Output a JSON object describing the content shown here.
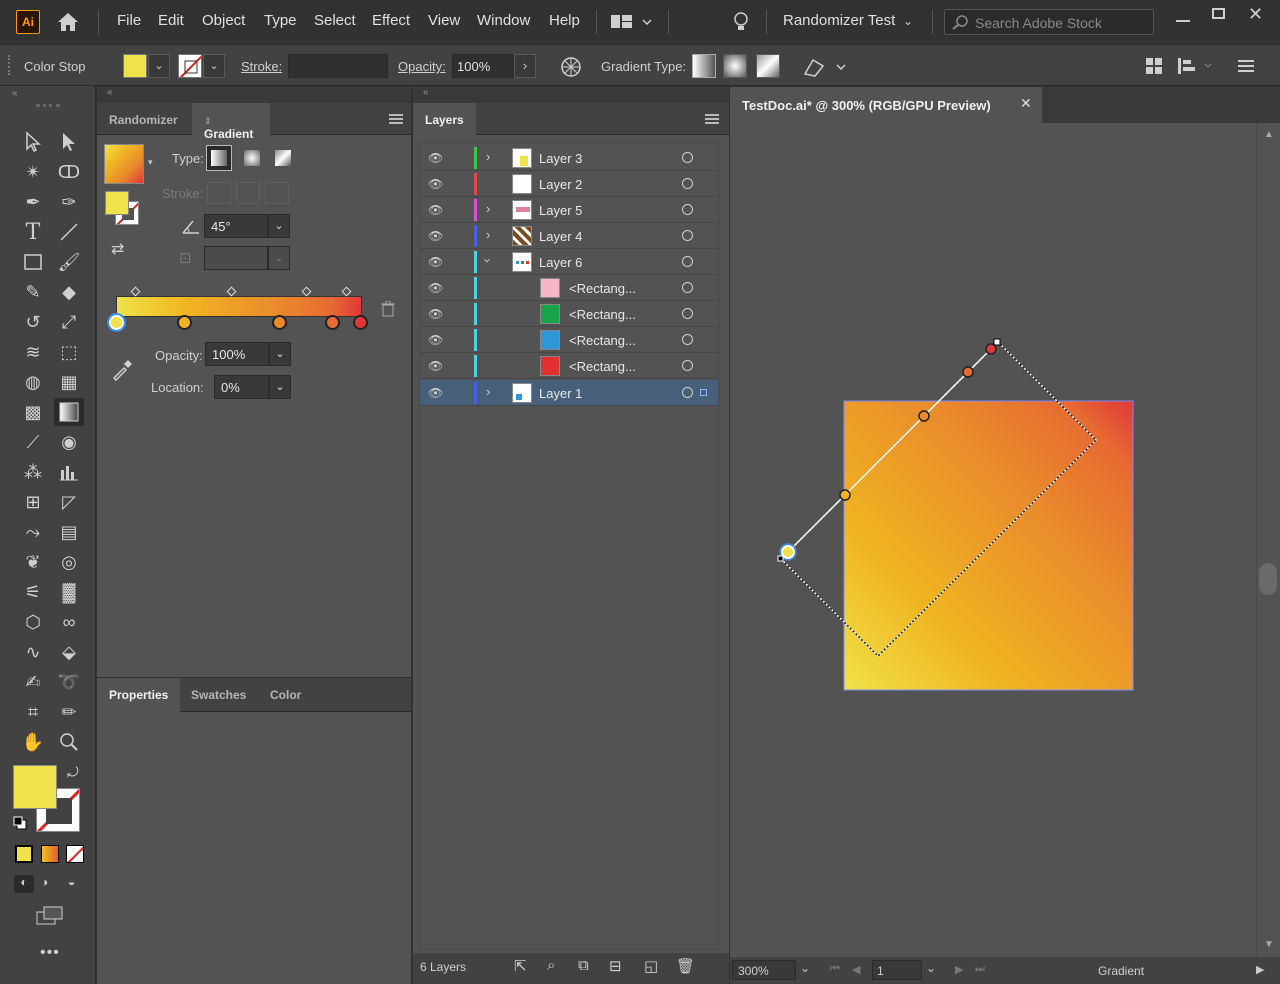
{
  "app": {
    "logo": "Ai",
    "doc_title": "Randomizer Test",
    "search_placeholder": "Search Adobe Stock"
  },
  "menu": [
    "File",
    "Edit",
    "Object",
    "Type",
    "Select",
    "Effect",
    "View",
    "Window",
    "Help"
  ],
  "control_bar": {
    "context_label": "Color Stop",
    "stroke_label": "Stroke:",
    "opacity_label": "Opacity:",
    "opacity_value": "100%",
    "gradient_type_label": "Gradient Type:"
  },
  "gradient_panel": {
    "tabs": [
      "Randomizer",
      "Gradient"
    ],
    "type_label": "Type:",
    "stroke_label": "Stroke:",
    "angle_value": "45°",
    "opacity_label": "Opacity:",
    "opacity_value": "100%",
    "location_label": "Location:",
    "location_value": "0%",
    "colors": {
      "start": "#f0e24a",
      "mid1": "#f0b521",
      "mid2": "#e98a2c",
      "mid3": "#e76a32",
      "end": "#e03838"
    }
  },
  "bottom_panel": {
    "tabs": [
      "Properties",
      "Swatches",
      "Color"
    ]
  },
  "layers_panel": {
    "title": "Layers",
    "footer": "6 Layers",
    "rows": [
      {
        "name": "Layer 3",
        "color": "#3ec446",
        "expand": true
      },
      {
        "name": "Layer 2",
        "color": "#e24b4b",
        "expand": false
      },
      {
        "name": "Layer 5",
        "color": "#d653d6",
        "expand": true
      },
      {
        "name": "Layer 4",
        "color": "#4b5fe2",
        "expand": true
      },
      {
        "name": "Layer 6",
        "color": "#4bd3e2",
        "expand": true
      },
      {
        "name": "<Rectang...",
        "color": "#4bd3e2",
        "swatch": "#f7b6c8"
      },
      {
        "name": "<Rectang...",
        "color": "#4bd3e2",
        "swatch": "#19a34a"
      },
      {
        "name": "<Rectang...",
        "color": "#4bd3e2",
        "swatch": "#3196d8"
      },
      {
        "name": "<Rectang...",
        "color": "#4bd3e2",
        "swatch": "#e03030"
      },
      {
        "name": "Layer 1",
        "color": "#4b5fe2",
        "expand": true
      }
    ]
  },
  "document": {
    "tab_title": "TestDoc.ai* @ 300% (RGB/GPU Preview)",
    "zoom": "300%",
    "artboard": "1",
    "status": "Gradient"
  }
}
